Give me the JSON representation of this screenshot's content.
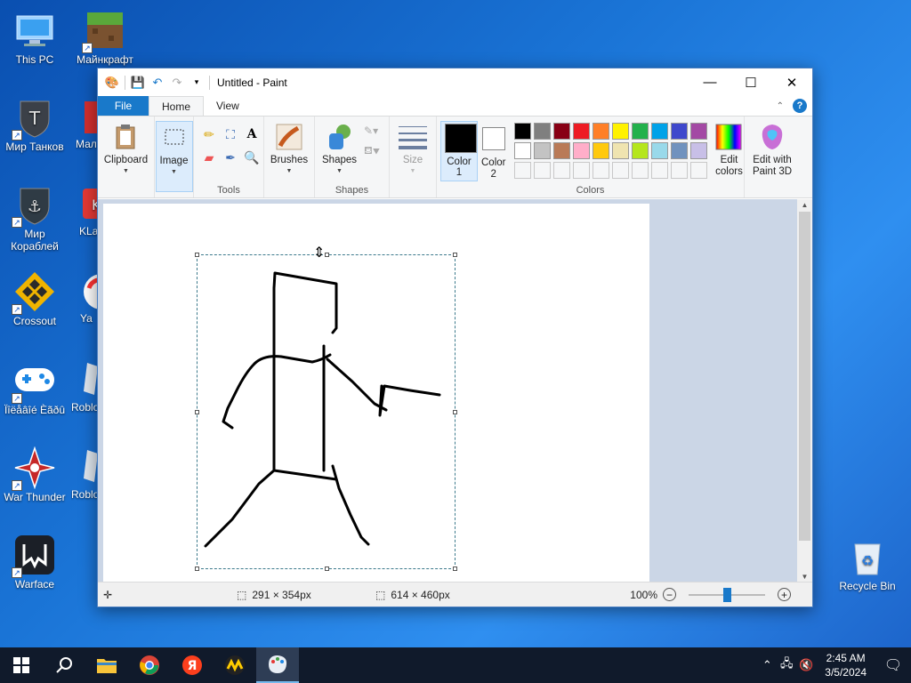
{
  "desktop": {
    "icons": [
      {
        "label": "This PC"
      },
      {
        "label": "Майнкрафт"
      },
      {
        "label": "Мир Танков"
      },
      {
        "label": "Мал"
      },
      {
        "label": "Мир Кораблей"
      },
      {
        "label": "KLa"
      },
      {
        "label": "Crossout"
      },
      {
        "label": "Ya"
      },
      {
        "label": "Ïîëåâîé Èãðû"
      },
      {
        "label": "Roblo"
      },
      {
        "label": "War Thunder"
      },
      {
        "label": "Roblo"
      },
      {
        "label": "Warface"
      },
      {
        "label": "Recycle Bin"
      }
    ]
  },
  "window": {
    "title": "Untitled - Paint",
    "tabs": [
      "File",
      "Home",
      "View"
    ],
    "ribbon": {
      "clipboard": "Clipboard",
      "image": "Image",
      "tools_group": "Tools",
      "brushes": "Brushes",
      "shapes": "Shapes",
      "shapes_group": "Shapes",
      "size": "Size",
      "color1": "Color\n1",
      "color1_a": "Color",
      "color1_b": "1",
      "color2_a": "Color",
      "color2_b": "2",
      "colors_group": "Colors",
      "edit_colors_a": "Edit",
      "edit_colors_b": "colors",
      "paint3d_a": "Edit with",
      "paint3d_b": "Paint 3D"
    },
    "palette_row1": [
      "#000000",
      "#7f7f7f",
      "#880015",
      "#ed1c24",
      "#ff7f27",
      "#fff200",
      "#22b14c",
      "#00a2e8",
      "#3f48cc",
      "#a349a4"
    ],
    "palette_row2": [
      "#ffffff",
      "#c3c3c3",
      "#b97a57",
      "#ffaec9",
      "#ffc90e",
      "#efe4b0",
      "#b5e61d",
      "#99d9ea",
      "#7092be",
      "#c8bfe7"
    ],
    "color1_value": "#000000",
    "color2_value": "#ffffff",
    "status": {
      "selection_size": "291 × 354px",
      "canvas_size": "614 × 460px",
      "zoom": "100%"
    }
  },
  "taskbar": {
    "time": "2:45 AM",
    "date": "3/5/2024"
  }
}
